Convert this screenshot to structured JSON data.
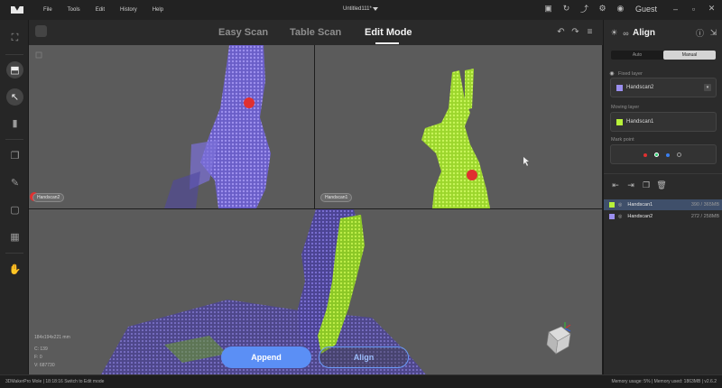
{
  "menubar": {
    "items": [
      "File",
      "Tools",
      "Edit",
      "History",
      "Help"
    ],
    "doc_title": "Untitled111*",
    "user": "Guest"
  },
  "left_toolbar": {
    "tools": [
      "fullscreen-icon",
      "scan-icon",
      "select-icon",
      "delete-icon",
      "copy-icon",
      "pen-icon",
      "crop-icon",
      "checker-icon",
      "hand-icon"
    ]
  },
  "modes": {
    "tabs": [
      "Easy Scan",
      "Table Scan",
      "Edit Mode"
    ],
    "active": "Edit Mode"
  },
  "viewports": {
    "fixed_label": "Handscan2",
    "moving_label": "Handscan1",
    "bounds": "184x194x221 mm",
    "info_c": "C: 139",
    "info_f": "F: 0",
    "info_v": "V: 687730"
  },
  "actions": {
    "append": "Append",
    "align": "Align"
  },
  "panel": {
    "title": "Align",
    "seg_auto": "Auto",
    "seg_manual": "Manual",
    "fixed_layer_label": "Fixed layer",
    "fixed_layer_value": "Handscan2",
    "moving_layer_label": "Moving layer",
    "moving_layer_value": "Handscan1",
    "mark_point_label": "Mark point",
    "layers": [
      {
        "name": "Handscan1",
        "size": "390 / 365MB",
        "color": "#b8f23a",
        "selected": true
      },
      {
        "name": "Handscan2",
        "size": "272 / 258MB",
        "color": "#9b8ff0",
        "selected": false
      }
    ]
  },
  "status": {
    "left": "3DMakerPro Mole  |  18:18:16 Switch to Edit mode",
    "right": "Memory usage: 5%  |  Memory used: 1863MB  |  v2.6.2"
  },
  "colors": {
    "accent": "#5b8ff5",
    "moving_layer": "#b8f23a",
    "fixed_layer": "#9b8ff0",
    "marker": "#e03030"
  }
}
